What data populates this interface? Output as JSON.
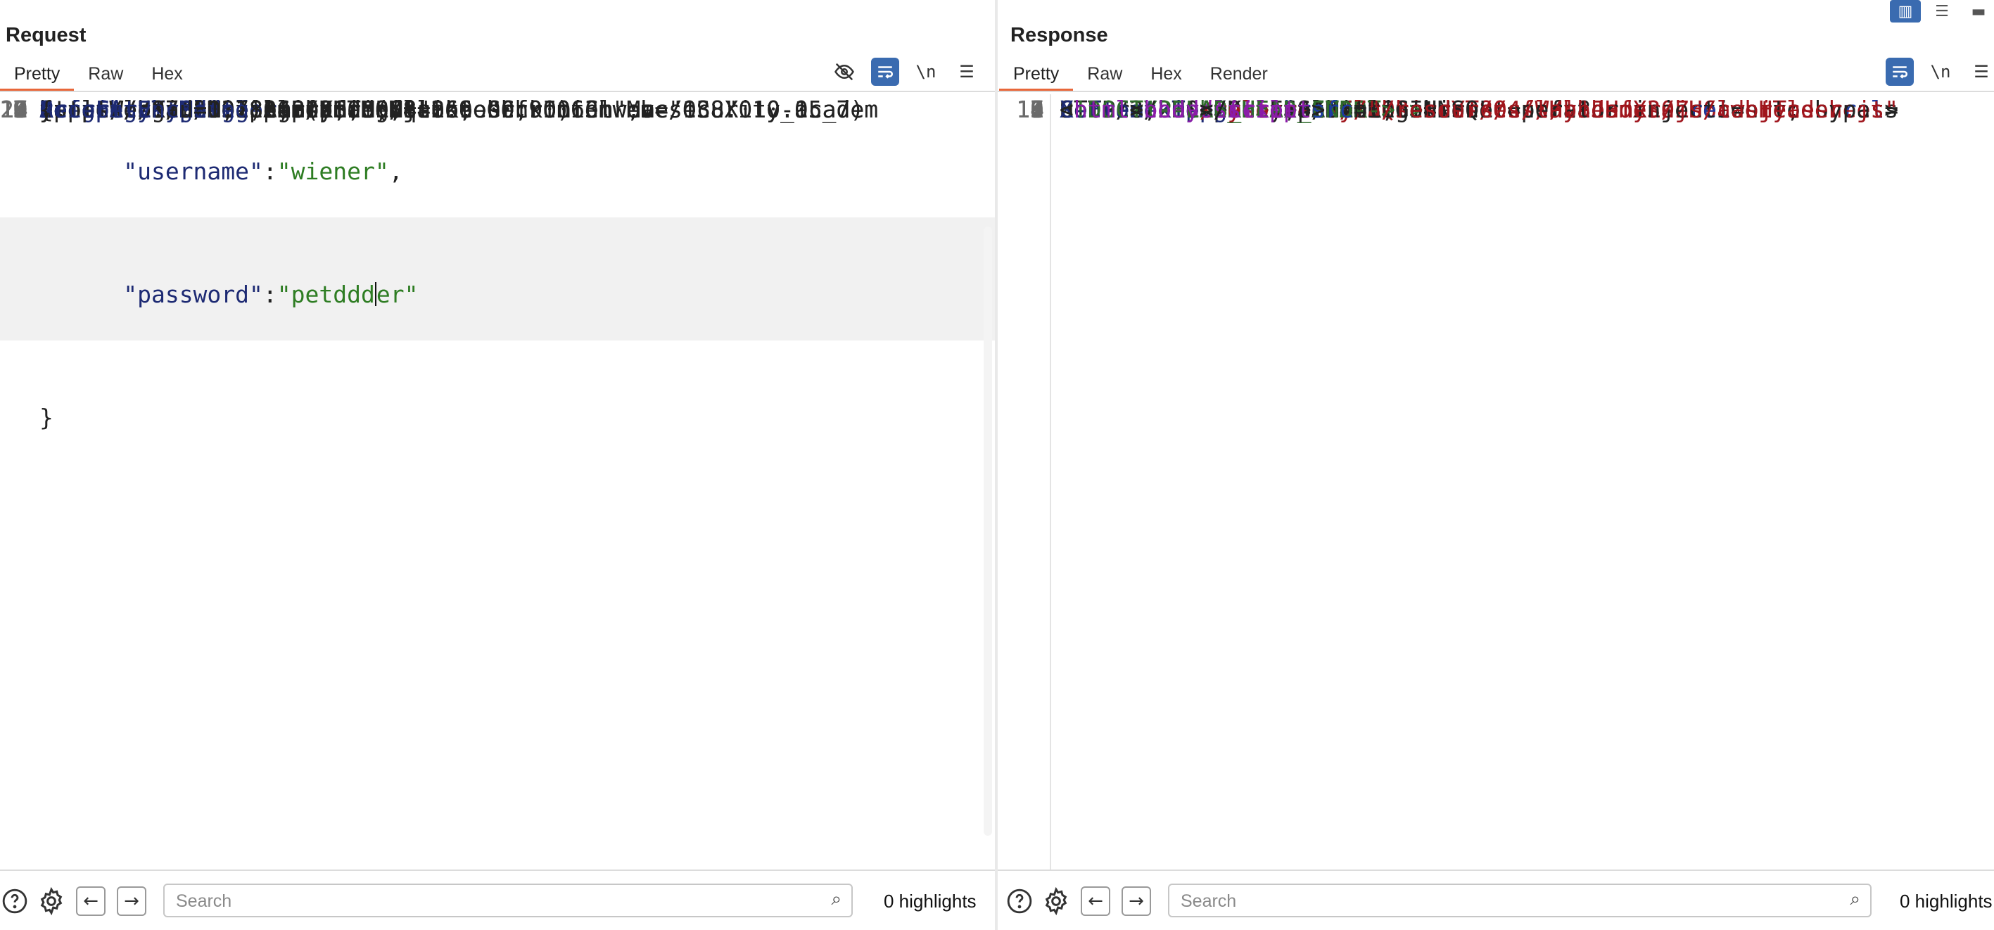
{
  "request": {
    "title": "Request",
    "tabs": [
      "Pretty",
      "Raw",
      "Hex"
    ],
    "active_tab": "Pretty",
    "tools": {
      "hide_icon": "eye-slash-icon",
      "wrap_icon": "wrap-lines-icon",
      "newline_label": "\\n",
      "menu_icon": "hamburger-menu-icon"
    },
    "lines": [
      {
        "num": "5",
        "key": "Sec-Ch-Ua-Platform",
        "val": ": \"macOS\""
      },
      {
        "num": "6",
        "key": "Accept-Language",
        "val": ": en-US,en;q=0.9"
      },
      {
        "num": "7",
        "key": "Sec-Ch-Ua",
        "val": ": \"Not)A;Brand\";v=\"8\", \"Chromium\";v=\"138\""
      },
      {
        "num": "8",
        "key": "Content-Type",
        "val": ": application/json"
      },
      {
        "num": "9",
        "key": "Sec-Ch-Ua-Mobile",
        "val": ": ?0"
      },
      {
        "num": "10",
        "key": "User-Agent",
        "val": ": Mozilla/5.0 (Macintosh; Intel Mac OS X 10_15_7)"
      },
      {
        "num": "",
        "key": "",
        "val": "AppleWebKit/537.36 (KHTML, like Gecko) Chrome/138.0.0.0"
      },
      {
        "num": "",
        "key": "",
        "val": "Safari/537.36"
      },
      {
        "num": "11",
        "key": "Accept",
        "val": ": */*"
      },
      {
        "num": "12",
        "key": "Origin",
        "val": ":"
      },
      {
        "num": "",
        "key": "",
        "val": "https://0ad80018048b2fa5808a266e00f90063.web-security-academ"
      },
      {
        "num": "",
        "key": "",
        "val": "y.net"
      },
      {
        "num": "13",
        "key": "Sec-Fetch-Site",
        "val": ": same-origin"
      },
      {
        "num": "14",
        "key": "Sec-Fetch-Mode",
        "val": ": cors"
      },
      {
        "num": "15",
        "key": "Sec-Fetch-Dest",
        "val": ": empty"
      },
      {
        "num": "16",
        "key": "Referer",
        "val": ":"
      },
      {
        "num": "",
        "key": "",
        "val": "https://0ad80018048b2fa5808a266e00f90063.web-security-academ"
      },
      {
        "num": "",
        "key": "",
        "val": "y.net/login"
      },
      {
        "num": "17",
        "key": "Accept-Encoding",
        "val": ": gzip, deflate, br"
      },
      {
        "num": "18",
        "key": "Priority",
        "val": ": u=1, i"
      },
      {
        "num": "19",
        "key": "",
        "val": ""
      },
      {
        "num": "20",
        "key": "",
        "val": "{"
      }
    ],
    "json_body": {
      "username_key": "\"username\"",
      "username_val": "\"wiener\"",
      "password_key": "\"password\"",
      "password_val_before": "\"petddd",
      "password_val_after": "er\"",
      "close": "}"
    },
    "footer": {
      "search_placeholder": "Search",
      "highlights": "0 highlights"
    }
  },
  "response": {
    "title": "Response",
    "tabs": [
      "Pretty",
      "Raw",
      "Hex",
      "Render"
    ],
    "active_tab": "Pretty",
    "tools": {
      "wrap_icon": "wrap-lines-icon",
      "newline_label": "\\n",
      "menu_icon": "hamburger-menu-icon"
    },
    "status_line": "HTTP/2 200 OK",
    "headers": {
      "content_type_key": "Content-Type",
      "content_type_val": ": text/html; charset=utf-8",
      "set_cookie_key": "Set-Cookie",
      "cookie_name": "session",
      "cookie_value": "yCJQ3ircYT8O4fWHy1JHfX30Zr6cwbjT",
      "cookie_rest": "Secure; HttpOnly; SameSite=None",
      "xfo_key": "X-Frame-Options",
      "xfo_val": ": SAMEORIGIN",
      "cl_key": "Content-Length",
      "cl_val": ": 6463"
    },
    "html": {
      "doctype": "<!DOCTYPE html>",
      "html_tag": "html",
      "comment_start": "<!--LAB_HEAD_START-->",
      "head_tag": "head",
      "link_tag": "link",
      "href_attr": "href",
      "css1": "/resources/labheader/css/academyLabHeader.css",
      "rel_attr": "rel",
      "stylesheet": "stylesheet",
      "css2": "/resources/css/labs.css",
      "title_tag": "title",
      "title_text_1": "Exploiting NoSQL operator injection to bypass",
      "title_text_2": "authentication",
      "comment_end": "<!--LAB_HEAD_END-->",
      "body_tag": "body",
      "script_tag": "script",
      "src_attr": "src",
      "js_src": "\"/resources/labheader/js/labHeader.js\""
    },
    "footer": {
      "search_placeholder": "Search",
      "highlights": "0 highlights"
    }
  },
  "layout_buttons": {
    "split_icon": "split-columns-icon",
    "rows_icon": "split-rows-icon",
    "tabs_icon": "single-pane-icon"
  }
}
